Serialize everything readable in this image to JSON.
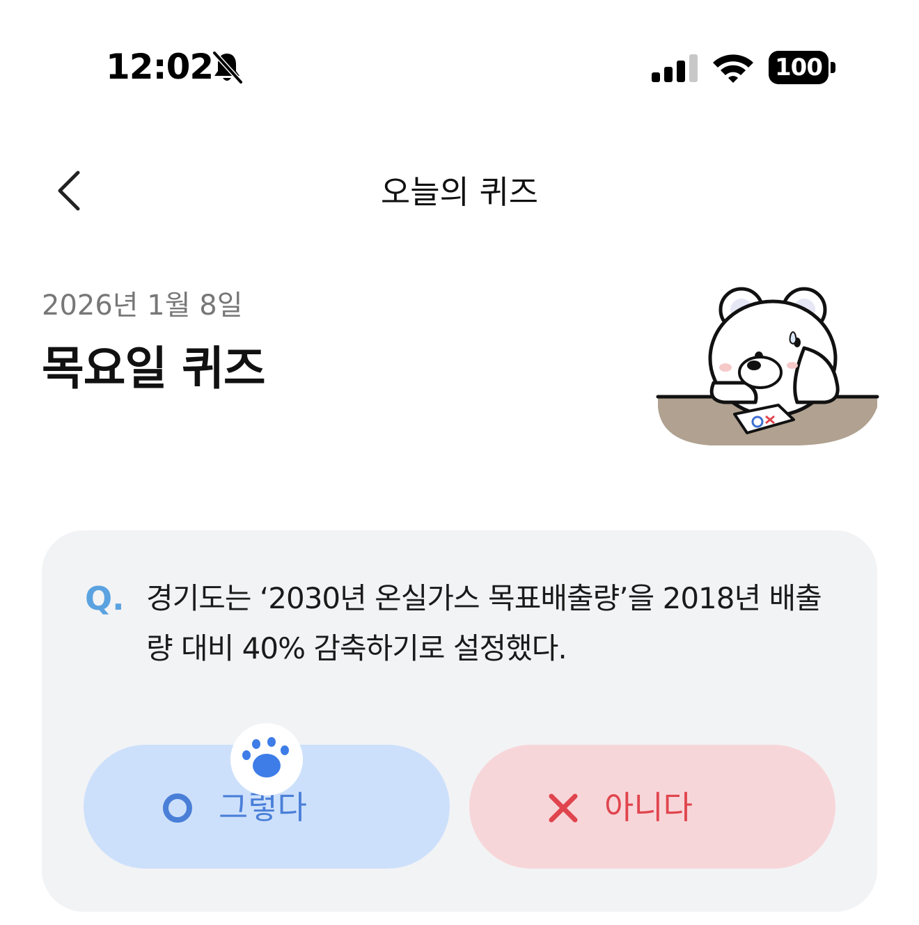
{
  "status_bar": {
    "time": "12:02",
    "battery": "100",
    "icons": [
      "bell-slash-icon",
      "signal-icon",
      "wifi-icon",
      "battery-icon"
    ]
  },
  "header": {
    "title": "오늘의 퀴즈",
    "back_icon": "chevron-left-icon"
  },
  "quiz": {
    "date": "2026년 1월 8일",
    "title": "목요일 퀴즈",
    "illustration": "bear-thinking-illustration",
    "question_marker": "Q.",
    "question": "경기도는 ‘2030년 온실가스 목표배출량’을 2018년 배출량 대비 40% 감축하기로 설정했다.",
    "answers": {
      "yes": {
        "label": "그렇다",
        "icon": "circle-o-icon",
        "color": "#4a7fd8",
        "background": "#cde0fb"
      },
      "no": {
        "label": "아니다",
        "icon": "x-mark-icon",
        "color": "#e0454e",
        "background": "#f7d6d9"
      }
    },
    "paw_icon": "paw-icon"
  },
  "colors": {
    "card_background": "#f2f3f5",
    "question_marker": "#5aa2e0",
    "date_text": "#777777"
  }
}
